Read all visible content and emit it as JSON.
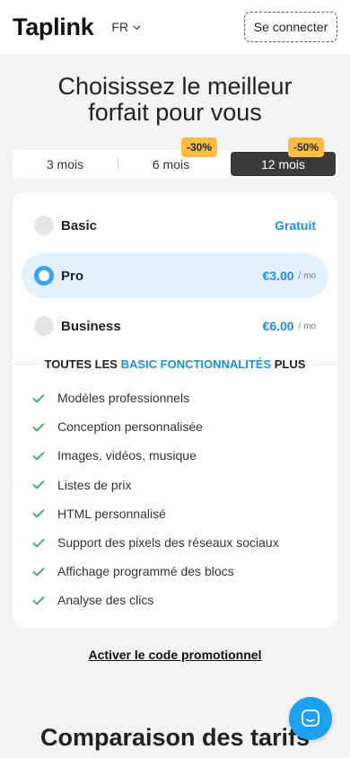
{
  "header": {
    "logo": "Taplink",
    "language": "FR",
    "login_label": "Se connecter"
  },
  "page_title": "Choisissez le meilleur forfait pour vous",
  "periods": [
    {
      "label": "3 mois",
      "active": false,
      "discount": ""
    },
    {
      "label": "6 mois",
      "active": false,
      "discount": "-30%"
    },
    {
      "label": "12 mois",
      "active": true,
      "discount": "-50%"
    }
  ],
  "plans": [
    {
      "name": "Basic",
      "price": "Gratuit",
      "unit": "",
      "selected": false
    },
    {
      "name": "Pro",
      "price": "€3.00",
      "unit": "/ mo",
      "selected": true
    },
    {
      "name": "Business",
      "price": "€6.00",
      "unit": "/ mo",
      "selected": false
    }
  ],
  "features_heading": {
    "prefix": "TOUTES LES",
    "accent": "BASIC FONCTIONNALITÉS",
    "suffix": "PLUS"
  },
  "features": [
    "Modèles professionnels",
    "Conception personnalisée",
    "Images, vidéos, musique",
    "Listes de prix",
    "HTML personnalisé",
    "Support des pixels des réseaux sociaux",
    "Affichage programmé des blocs",
    "Analyse des clics"
  ],
  "promo_link": "Activer le code promotionnel",
  "compare_title": "Comparaison des tarifs",
  "colors": {
    "accent": "#1a8fe3",
    "check": "#3aa657",
    "discount_badge": "#fbbd45",
    "active_tab": "#3a3a3a",
    "selected_plan_bg": "#e1f1fd",
    "chat_button": "#1ea0f0"
  },
  "icons": {
    "language": "chevron-down-icon",
    "feature": "check-icon",
    "chat": "chat-bubble-icon"
  }
}
